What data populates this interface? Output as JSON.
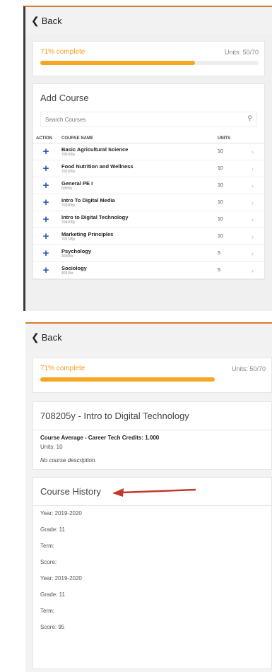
{
  "top": {
    "back": "Back",
    "progress_text": "71% complete",
    "progress_fraction": 0.71,
    "units_text": "Units: 50/70",
    "section_title": "Add Course",
    "search_placeholder": "Search Courses",
    "table_headers": [
      "ACTION",
      "COURSE NAME",
      "UNITS"
    ],
    "courses": [
      {
        "name": "Basic Agricultural Science",
        "code": "700105y",
        "units": "10"
      },
      {
        "name": "Food Nutrition and Wellness",
        "code": "702105y",
        "units": "10"
      },
      {
        "name": "General PE I",
        "code": "600t5y",
        "units": "10"
      },
      {
        "name": "Intro To Digital Media",
        "code": "703305y",
        "units": "10"
      },
      {
        "name": "Intro to Digital Technology",
        "code": "708205y",
        "units": "10"
      },
      {
        "name": "Marketing Principles",
        "code": "702745y",
        "units": "10"
      },
      {
        "name": "Psychology",
        "code": "40305s",
        "units": "5"
      },
      {
        "name": "Sociology",
        "code": "40315s",
        "units": "5"
      }
    ]
  },
  "bottom": {
    "back": "Back",
    "progress_text": "71% complete",
    "progress_fraction": 0.71,
    "units_text": "Units: 50/70",
    "course_title": "708205y - Intro to Digital Technology",
    "avg_text": "Course Average - Career Tech Credits: 1.000",
    "units_line": "Units: 10",
    "no_desc": "No course description.",
    "history_title": "Course History",
    "history": [
      "Year: 2019-2020",
      "Grade: 11",
      "Term:",
      "Score:",
      "Year: 2019-2020",
      "Grade: 11",
      "Term:",
      "Score: 95"
    ]
  },
  "colors": {
    "accent_orange": "#f5a623",
    "plus_blue": "#2b5fb3",
    "arrow_red": "#c0392b"
  }
}
